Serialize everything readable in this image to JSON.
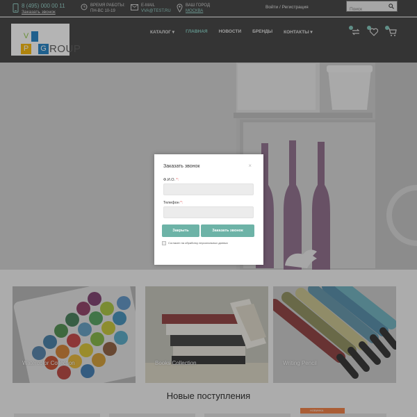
{
  "topbar": {
    "phone": "8 (495) 000 00 11",
    "callback_link": "Заказать звонок",
    "hours_label": "Время работы:",
    "hours_value": "Пн-Вс 10-19",
    "email_label": "E-mail",
    "email_value": "vva@test.ru",
    "city_label": "Ваш город",
    "city_value": "Москва",
    "login_link": "Войти / Регистрация",
    "search_placeholder": "Поиск"
  },
  "logo": {
    "letters": [
      "V",
      "P",
      "G"
    ],
    "text": "ROUP",
    "colors": {
      "v": "#8cc63f",
      "p": "#f7b500",
      "g": "#1b7fc4"
    }
  },
  "nav": {
    "items": [
      "Каталог",
      "Главная",
      "Новости",
      "Бренды",
      "Контакты"
    ],
    "active": "Главная"
  },
  "header_icons": [
    "compare-icon",
    "favorites-icon",
    "cart-icon"
  ],
  "categories": [
    {
      "label": "Watercolor Collection"
    },
    {
      "label": "Books Collection"
    },
    {
      "label": "Writing Pencil"
    }
  ],
  "section_title": "Новые поступления",
  "new_badge": "НОВИНКА",
  "modal": {
    "title": "Заказать звонок",
    "close": "×",
    "name_label": "Ф.И.О.",
    "phone_label": "Телефон",
    "required_mark": "*:",
    "close_button": "Закрыть",
    "submit_button": "Заказать звонок",
    "consent": "Согласен на обработку персональных данных"
  },
  "colors": {
    "accent": "#6db3a7",
    "dark": "#3b3b3b",
    "required": "#e25050"
  }
}
